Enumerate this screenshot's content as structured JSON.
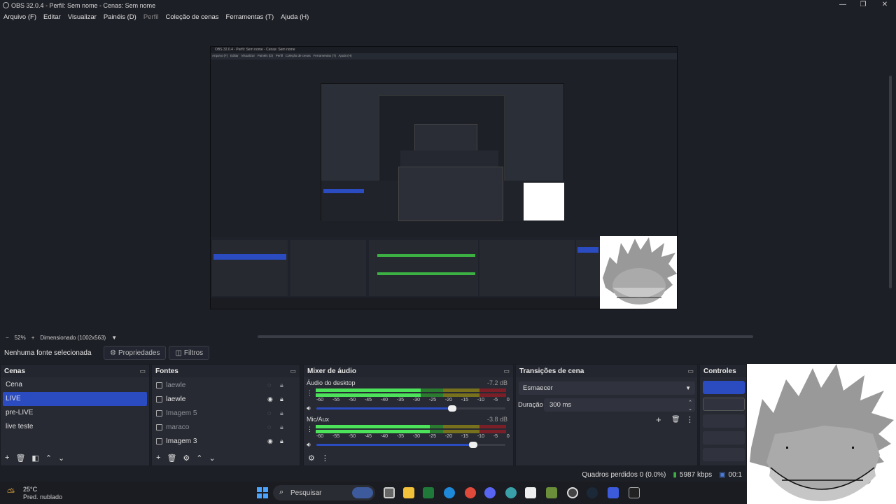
{
  "window": {
    "title": "OBS 32.0.4 - Perfil: Sem nome - Cenas: Sem nome"
  },
  "menu": [
    "Arquivo (F)",
    "Editar",
    "Visualizar",
    "Painéis (D)",
    "Perfil",
    "Coleção de cenas",
    "Ferramentas (T)",
    "Ajuda (H)"
  ],
  "preview": {
    "zoom": "52%",
    "scale_mode": "Dimensionado (1002x563)",
    "nested_title": "OBS 32.0.4 - Perfil: Sem nome - Cenas: Sem nome"
  },
  "source_bar": {
    "no_source": "Nenhuma fonte selecionada",
    "properties": "Propriedades",
    "filters": "Filtros"
  },
  "scenes": {
    "title": "Cenas",
    "items": [
      "Cena",
      "LIVE",
      "pre-LIVE",
      "live teste"
    ],
    "selected": "LIVE"
  },
  "sources": {
    "title": "Fontes",
    "items": [
      {
        "name": "laewle",
        "visible": false
      },
      {
        "name": "laewle",
        "visible": true
      },
      {
        "name": "Imagem 5",
        "visible": false
      },
      {
        "name": "maraco",
        "visible": false
      },
      {
        "name": "Imagem 3",
        "visible": true
      }
    ]
  },
  "mixer": {
    "title": "Mixer de áudio",
    "channels": [
      {
        "name": "Áudio do desktop",
        "db": "-7.2 dB",
        "level": 0.55,
        "volume": 0.72
      },
      {
        "name": "Mic/Aux",
        "db": "-3.8 dB",
        "level": 0.6,
        "volume": 0.83
      }
    ],
    "scale": [
      "-60",
      "-55",
      "-50",
      "-45",
      "-40",
      "-35",
      "-30",
      "-25",
      "-20",
      "-15",
      "-10",
      "-5",
      "0"
    ]
  },
  "transitions": {
    "title": "Transições de cena",
    "selected": "Esmaecer",
    "duration_label": "Duração",
    "duration": "300 ms"
  },
  "controls": {
    "title": "Controles"
  },
  "status": {
    "dropped": "Quadros perdidos 0 (0.0%)",
    "bitrate": "5987 kbps",
    "time": "00:1"
  },
  "taskbar": {
    "weather_temp": "25°C",
    "weather_desc": "Pred. nublado",
    "search": "Pesquisar"
  },
  "colors": {
    "accent": "#2b4bc1",
    "bg": "#1d1f26",
    "dock": "#272a33"
  }
}
